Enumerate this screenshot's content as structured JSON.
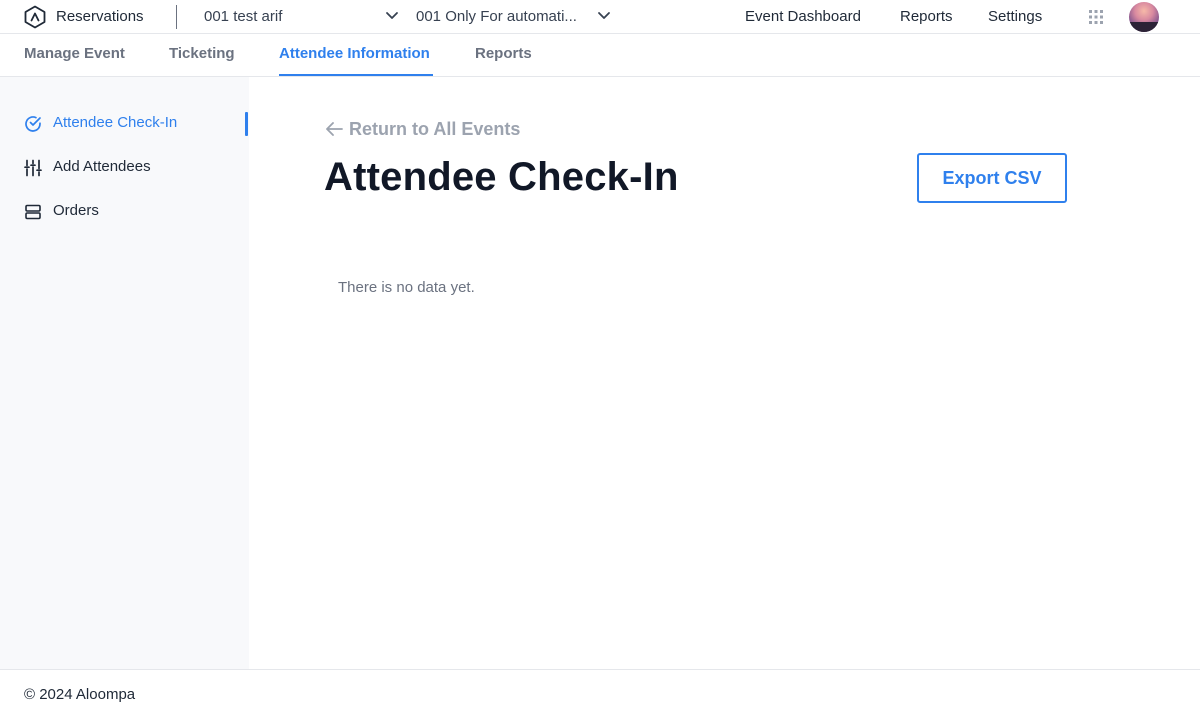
{
  "topbar": {
    "app_title": "Reservations",
    "org_selected": "001 test arif",
    "event_selected": "001 Only For automati...",
    "nav": [
      "Event Dashboard",
      "Reports",
      "Settings"
    ],
    "icons": [
      "logo-icon",
      "chevron-down-icon",
      "apps-grid-icon",
      "avatar"
    ]
  },
  "tabs": {
    "items": [
      "Manage Event",
      "Ticketing",
      "Attendee Information",
      "Reports"
    ],
    "active": "Attendee Information"
  },
  "sidebar": {
    "items": [
      {
        "label": "Attendee Check-In",
        "icon": "check-circle-icon",
        "active": true
      },
      {
        "label": "Add Attendees",
        "icon": "sliders-icon",
        "active": false
      },
      {
        "label": "Orders",
        "icon": "server-icon",
        "active": false
      }
    ]
  },
  "main": {
    "return_link": "Return to All Events",
    "title": "Attendee Check-In",
    "export_button": "Export CSV",
    "empty_message": "There is no data yet."
  },
  "footer": {
    "copyright": "© 2024 Aloompa"
  },
  "colors": {
    "accent": "#2f80ed",
    "sidebar_bg": "#f8f9fb",
    "muted_text": "#9ca3af"
  }
}
